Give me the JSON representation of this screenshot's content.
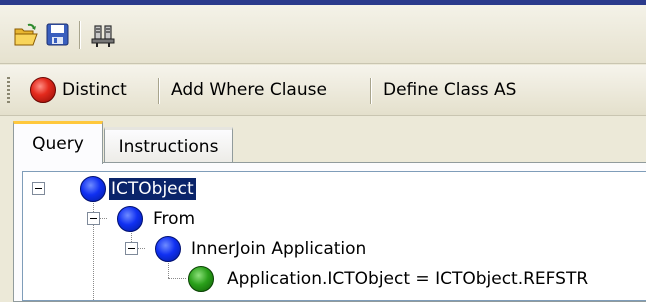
{
  "toolbar_top": {
    "icons": [
      "open-folder-icon",
      "save-icon",
      "connect-icon"
    ]
  },
  "toolbar_actions": {
    "distinct_label": "Distinct",
    "add_where_label": "Add Where Clause",
    "define_class_label": "Define Class AS"
  },
  "tabs": [
    {
      "label": "Query",
      "active": true
    },
    {
      "label": "Instructions",
      "active": false
    }
  ],
  "tree": {
    "root": "ICTObject",
    "from": "From",
    "join": "InnerJoin  Application",
    "condition": "Application.ICTObject = ICTObject.REFSTR"
  },
  "colors": {
    "selection": "#0a246a",
    "node_blue": "#1030f2",
    "node_green": "#2aa01a",
    "distinct_red": "#e42a1d"
  }
}
